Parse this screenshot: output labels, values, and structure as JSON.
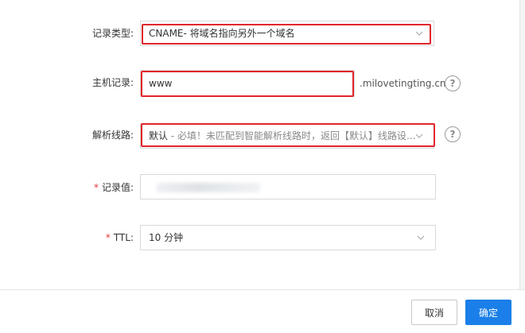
{
  "form": {
    "record_type": {
      "label": "记录类型:",
      "value": "CNAME- 将域名指向另外一个域名"
    },
    "host": {
      "label": "主机记录:",
      "value": "www",
      "suffix": ".milovetingting.cn"
    },
    "line": {
      "label": "解析线路:",
      "value_bold": "默认",
      "value_rest": " - 必填！未匹配到智能解析线路时，返回【默认】线路设..."
    },
    "record_value": {
      "required_mark": "*",
      "label": "记录值:",
      "value": ""
    },
    "ttl": {
      "required_mark": "*",
      "label": "TTL:",
      "value": "10 分钟"
    }
  },
  "help_symbol": "?",
  "footer": {
    "cancel_label": "取消",
    "ok_label": "确定"
  },
  "colors": {
    "highlight": "#e0262b",
    "primary": "#1a7fe8",
    "required": "#e4393c"
  }
}
